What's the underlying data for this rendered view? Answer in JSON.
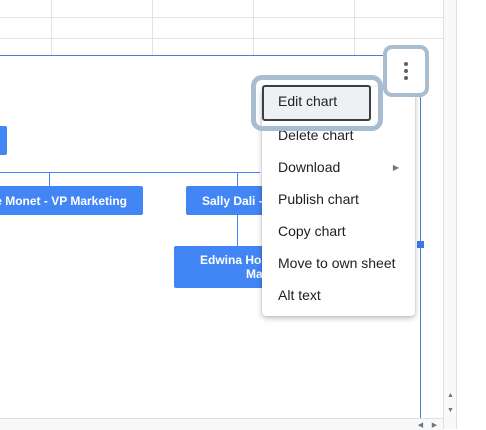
{
  "org_chart": {
    "nodes": [
      {
        "id": "partial-left",
        "label": ""
      },
      {
        "id": "vp-marketing",
        "label": "le Monet - VP Marketing"
      },
      {
        "id": "sally-dali",
        "label": "Sally Dali - "
      },
      {
        "id": "edwina",
        "label_line1": "Edwina Hop",
        "label_line2": "Ma"
      }
    ],
    "colors": {
      "node": "#4285f4",
      "frame": "#4a7fd0"
    }
  },
  "chart_menu": {
    "button_icon": "more-vert-icon",
    "items": [
      {
        "label": "Edit chart"
      },
      {
        "label": "Delete chart"
      },
      {
        "label": "Download",
        "has_submenu": true,
        "submenu_icon": "triangle-right-icon"
      },
      {
        "label": "Publish chart"
      },
      {
        "label": "Copy chart"
      },
      {
        "label": "Move to own sheet"
      },
      {
        "label": "Alt text"
      }
    ]
  },
  "scrollbar": {
    "up": "▲",
    "down": "▼",
    "left": "◀",
    "right": "▶"
  },
  "highlight_color": "#a8bdd0"
}
